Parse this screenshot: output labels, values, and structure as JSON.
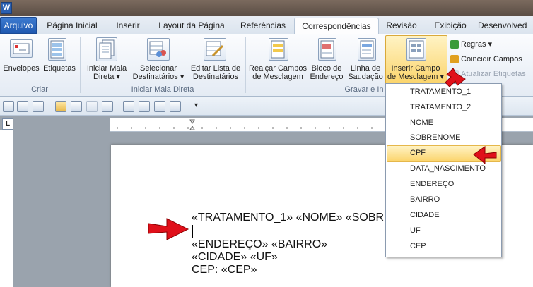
{
  "app": {
    "logo_letter": "W"
  },
  "tabs": {
    "file": "Arquivo",
    "home": "Página Inicial",
    "insert": "Inserir",
    "layout": "Layout da Página",
    "references": "Referências",
    "mailings": "Correspondências",
    "review": "Revisão",
    "view": "Exibição",
    "developer": "Desenvolved"
  },
  "ribbon": {
    "envelopes": "Envelopes",
    "labels": "Etiquetas",
    "start_mail_merge_1": "Iniciar Mala",
    "start_mail_merge_2": "Direta ▾",
    "select_recipients_1": "Selecionar",
    "select_recipients_2": "Destinatários ▾",
    "edit_list_1": "Editar Lista de",
    "edit_list_2": "Destinatários",
    "highlight_fields_1": "Realçar Campos",
    "highlight_fields_2": "de Mesclagem",
    "address_block_1": "Bloco de",
    "address_block_2": "Endereço",
    "greeting_line_1": "Linha de",
    "greeting_line_2": "Saudação",
    "insert_field_1": "Inserir Campo",
    "insert_field_2": "de Mesclagem ▾",
    "rules": "Regras ▾",
    "match_fields": "Coincidir Campos",
    "update_labels": "Atualizar Etiquetas",
    "group_create": "Criar",
    "group_start": "Iniciar Mala Direta",
    "group_write": "Gravar e In"
  },
  "dropdown": {
    "items": [
      "TRATAMENTO_1",
      "TRATAMENTO_2",
      "NOME",
      "SOBRENOME",
      "CPF",
      "DATA_NASCIMENTO",
      "ENDEREÇO",
      "BAIRRO",
      "CIDADE",
      "UF",
      "CEP"
    ],
    "highlighted": "CPF"
  },
  "ruler": {
    "corner": "L"
  },
  "document": {
    "line1": "«TRATAMENTO_1»  «NOME» «SOBR",
    "line3": "«ENDEREÇO» «BAIRRO»",
    "line4": "«CIDADE» «UF»",
    "line5": "CEP: «CEP»"
  },
  "colors": {
    "arrow": "#e0101a",
    "highlight": "#fbd46b",
    "file_tab": "#2a66c0"
  }
}
